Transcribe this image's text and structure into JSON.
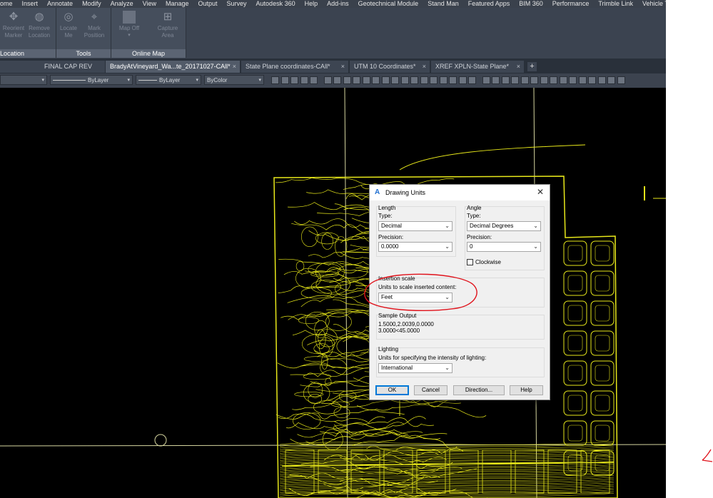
{
  "menu": [
    "ome",
    "Insert",
    "Annotate",
    "Modify",
    "Analyze",
    "View",
    "Manage",
    "Output",
    "Survey",
    "Autodesk 360",
    "Help",
    "Add-ins",
    "Geotechnical Module",
    "Stand Man",
    "Featured Apps",
    "BIM 360",
    "Performance",
    "Trimble Link",
    "Vehicle Tra"
  ],
  "ribbon": {
    "location": {
      "title": "Location",
      "reorient": "Reorient\nMarker",
      "remove": "Remove\nLocation"
    },
    "tools": {
      "title": "Tools",
      "locate": "Locate\nMe",
      "mark": "Mark\nPosition"
    },
    "online_map": {
      "title": "Online Map",
      "map_off": "Map Off",
      "capture": "Capture\nArea"
    }
  },
  "tabs": [
    {
      "label": "FINAL CAP REV",
      "active": false
    },
    {
      "label": "BradyAtVineyard_Wa...te_20171027-CAll*",
      "active": true
    },
    {
      "label": "State Plane coordinates-CAll*",
      "active": false
    },
    {
      "label": "UTM 10 Coordinates*",
      "active": false
    },
    {
      "label": "XREF XPLN-State Plane*",
      "active": false
    }
  ],
  "properties": {
    "linetype": "ByLayer",
    "lineweight": "ByLayer",
    "plotstyle": "ByColor"
  },
  "dialog": {
    "title": "Drawing Units",
    "length": {
      "group": "Length",
      "type_label": "Type:",
      "type_value": "Decimal",
      "precision_label": "Precision:",
      "precision_value": "0.0000"
    },
    "angle": {
      "group": "Angle",
      "type_label": "Type:",
      "type_value": "Decimal Degrees",
      "precision_label": "Precision:",
      "precision_value": "0",
      "clockwise": "Clockwise"
    },
    "insertion": {
      "group": "Insertion scale",
      "label": "Units to scale inserted content:",
      "value": "Feet"
    },
    "sample": {
      "group": "Sample Output",
      "line1": "1.5000,2.0039,0.0000",
      "line2": "3.0000<45.0000"
    },
    "lighting": {
      "group": "Lighting",
      "label": "Units for specifying the intensity of lighting:",
      "value": "International"
    },
    "buttons": {
      "ok": "OK",
      "cancel": "Cancel",
      "direction": "Direction...",
      "help": "Help"
    }
  },
  "colors": {
    "drawing": "#e8e81a",
    "annotation": "#e0111a",
    "grid_line": "#d6d6a0"
  }
}
